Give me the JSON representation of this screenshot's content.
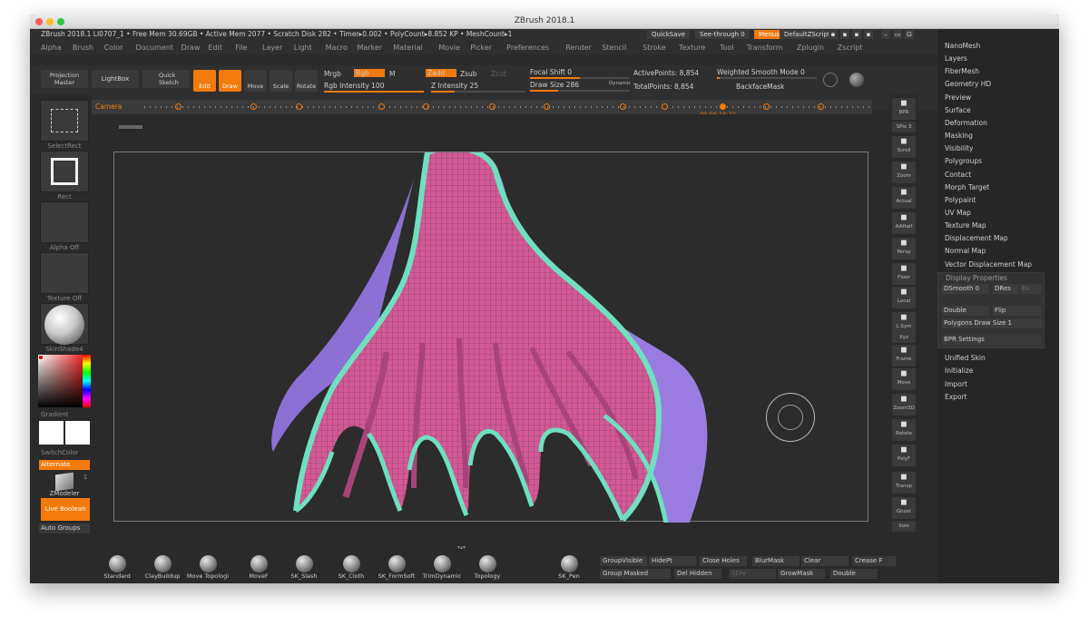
{
  "window": {
    "title": "ZBrush 2018.1"
  },
  "infobar": {
    "text": "ZBrush 2018.1 LI0707_1   • Free Mem 30.69GB • Active Mem 2077 • Scratch Disk 282 •   Timer▸0.002 • PolyCount▸8.852 KP • MeshCount▸1",
    "quicksave": "QuickSave",
    "seethrough": "See-through   0",
    "menus": "Menus",
    "script": "DefaultZScript"
  },
  "menubar": [
    "Alpha",
    "Brush",
    "Color",
    "Document",
    "Draw",
    "Edit",
    "File",
    "Layer",
    "Light",
    "Macro",
    "Marker",
    "Material",
    "Movie",
    "Picker",
    "Preferences",
    "Render",
    "Stencil",
    "Stroke",
    "Texture",
    "Tool",
    "Transform",
    "Zplugin",
    "Zscript"
  ],
  "toolbar": {
    "projection_master": "Projection Master",
    "lightbox": "LightBox",
    "quick_sketch": "Quick Sketch",
    "edit": "Edit",
    "draw": "Draw",
    "move": "Move",
    "scale": "Scale",
    "rotate": "Rotate",
    "mrgb": "Mrgb",
    "rgb": "Rgb",
    "m": "M",
    "zadd": "Zadd",
    "zsub": "Zsub",
    "zcut": "Zcut",
    "rgb_intensity": "Rgb Intensity 100",
    "z_intensity": "Z Intensity 25",
    "focal_shift": "Focal Shift 0",
    "draw_size": "Draw Size 286",
    "dynamic": "Dynamic",
    "active_points": "ActivePoints: 8,854",
    "total_points": "TotalPoints: 8,854",
    "weighted_smooth": "Weighted Smooth Mode 0",
    "backface_mask": "BackfaceMask",
    "camera": "Camera",
    "timecode": "00:56:23:72"
  },
  "leftpanel": {
    "select_rect": "SelectRect",
    "rect": "Rect",
    "alpha_off": "Alpha Off",
    "texture_off": "Texture Off",
    "material": "SkinShade4",
    "gradient": "Gradient",
    "switch_color": "SwitchColor",
    "alternate": "Alternate",
    "zmodeler": "ZModeler",
    "zmodeler_count": "1",
    "live_boolean": "Live Boolean",
    "auto_groups": "Auto Groups"
  },
  "rightshelf": [
    {
      "label": "BPR",
      "icon": "render-icon"
    },
    {
      "label": "SPix 3",
      "icon": ""
    },
    {
      "label": "Scroll",
      "icon": "hand-icon"
    },
    {
      "label": "Zoom",
      "icon": "zoom-icon"
    },
    {
      "label": "Actual",
      "icon": "actual-icon"
    },
    {
      "label": "AAHalf",
      "icon": "aahalf-icon"
    },
    {
      "label": "Persp",
      "icon": "persp-icon"
    },
    {
      "label": "Floor",
      "icon": "floor-icon"
    },
    {
      "label": "Local",
      "icon": "local-icon"
    },
    {
      "label": "L.Sym",
      "icon": "lsym-icon"
    },
    {
      "label": "Xyz",
      "icon": "xyz-icon"
    },
    {
      "label": "Frame",
      "icon": "frame-icon"
    },
    {
      "label": "Move",
      "icon": "move-icon"
    },
    {
      "label": "Zoom3D",
      "icon": "zoom3d-icon"
    },
    {
      "label": "Rotate",
      "icon": "rotate-icon"
    },
    {
      "label": "PolyF",
      "icon": "polyf-icon"
    },
    {
      "label": "Transp",
      "icon": "transp-icon"
    },
    {
      "label": "Ghost",
      "icon": "ghost-icon"
    },
    {
      "label": "Solo",
      "icon": "solo-icon"
    }
  ],
  "rightpanel": {
    "items_top": [
      "NanoMesh",
      "Layers",
      "FiberMesh",
      "Geometry HD",
      "Preview",
      "Surface",
      "Deformation",
      "Masking",
      "Visibility",
      "Polygroups",
      "Contact",
      "Morph Target",
      "Polypaint",
      "UV Map",
      "Texture Map",
      "Displacement Map",
      "Normal Map",
      "Vector Displacement Map"
    ],
    "display_properties": "Display Properties",
    "dsmooth": "DSmooth 0",
    "dres": "DRes",
    "ex": "Ex",
    "double": "Double",
    "flip": "Flip",
    "polygons_draw_size": "Polygons Draw Size 1",
    "bpr_settings": "BPR Settings",
    "items_bottom": [
      "Unified Skin",
      "Initialize",
      "Import",
      "Export"
    ]
  },
  "brushes": [
    "Standard",
    "ClayBuildup",
    "Move Topologi",
    "MoveF",
    "SK_Slash",
    "SK_Cloth",
    "SK_FormSoft",
    "TrimDynamic",
    "Topology",
    "SK_Pen"
  ],
  "bottombuttons": {
    "row1": [
      "GroupVisible",
      "HidePt",
      "Close Holes",
      "BlurMask",
      "Clear",
      "Crease F"
    ],
    "row2": [
      "Group Masked",
      "Del Hidden",
      "SDiv",
      "GrowMask",
      "Double"
    ]
  },
  "colors": {
    "accent": "#f47a0c",
    "mesh_pink": "#d35a96",
    "mesh_teal": "#6fe0bf",
    "mesh_purple": "#9a7ce0"
  }
}
